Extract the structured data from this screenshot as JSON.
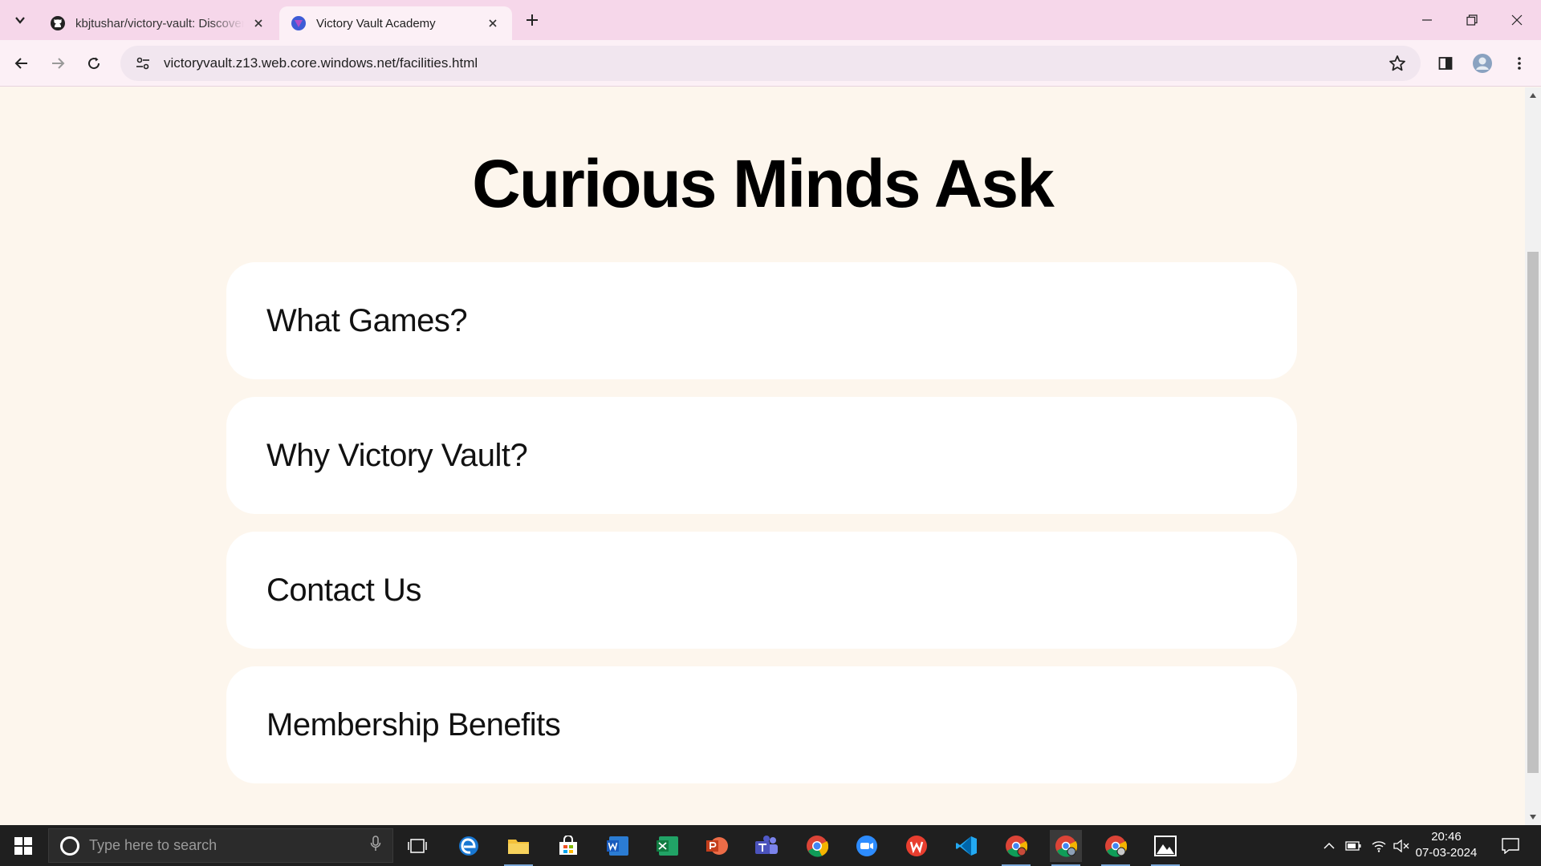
{
  "browser": {
    "tabs": [
      {
        "title": "kbjtushar/victory-vault: Discover",
        "active": false,
        "favicon": "github-icon"
      },
      {
        "title": "Victory Vault Academy",
        "active": true,
        "favicon": "site-icon"
      }
    ],
    "url": "victoryvault.z13.web.core.windows.net/facilities.html"
  },
  "page": {
    "heading": "Curious Minds Ask",
    "faqs": [
      {
        "question": "What Games?"
      },
      {
        "question": "Why Victory Vault?"
      },
      {
        "question": "Contact Us"
      },
      {
        "question": "Membership Benefits"
      }
    ]
  },
  "taskbar": {
    "search_placeholder": "Type here to search",
    "time": "20:46",
    "date": "07-03-2024",
    "apps": [
      "task-view-icon",
      "edge-icon",
      "file-explorer-icon",
      "store-icon",
      "word-icon",
      "excel-icon",
      "powerpoint-icon",
      "teams-icon",
      "chrome-icon",
      "zoom-icon",
      "wps-icon",
      "vscode-icon",
      "chrome-profile-icon",
      "chrome-active-icon",
      "chrome-profile2-icon",
      "photos-icon"
    ]
  },
  "colors": {
    "tabstrip": "#f6d7ea",
    "toolbar": "#fcf0f6",
    "page_bg": "#fdf6ed",
    "card_bg": "#ffffff",
    "taskbar": "#1f1f1f"
  }
}
